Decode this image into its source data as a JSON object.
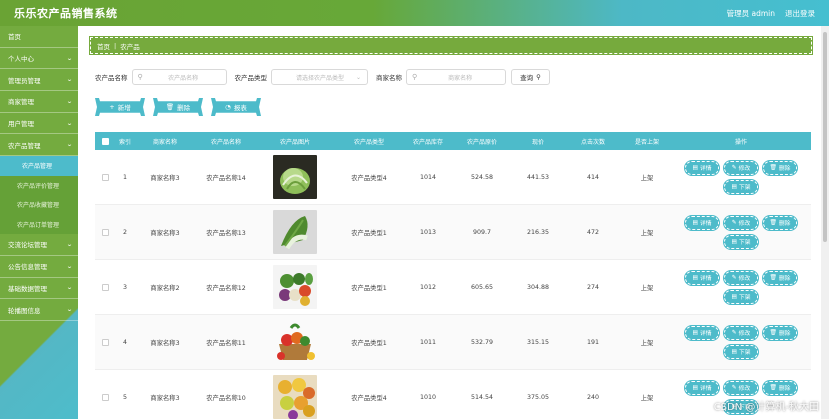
{
  "header": {
    "title": "乐乐农产品销售系统",
    "user": "管理员 admin",
    "logout": "退出登录"
  },
  "sidebar": {
    "items": [
      {
        "label": "首页",
        "chevron": false
      },
      {
        "label": "个人中心",
        "chevron": true
      },
      {
        "label": "管理员管理",
        "chevron": true
      },
      {
        "label": "商家管理",
        "chevron": true
      },
      {
        "label": "用户管理",
        "chevron": true
      },
      {
        "label": "农产品管理",
        "chevron": true
      }
    ],
    "submenu": [
      "农产品管理",
      "农产品评价管理",
      "农产品收藏管理",
      "农产品订单管理"
    ],
    "items_after": [
      {
        "label": "交流论坛管理"
      },
      {
        "label": "公告信息管理"
      },
      {
        "label": "基础数据管理"
      },
      {
        "label": "轮播图信息"
      }
    ]
  },
  "breadcrumb": {
    "home": "首页",
    "sep": "|",
    "current": "农产品"
  },
  "search": {
    "product_name_label": "农产品名称",
    "product_name_placeholder": "农产品名称",
    "product_type_label": "农产品类型",
    "product_type_placeholder": "请选择农产品类型",
    "shop_name_label": "商家名称",
    "shop_name_placeholder": "商家名称",
    "query_label": "查询"
  },
  "actions": {
    "add": "新增",
    "delete": "删除",
    "report": "报表"
  },
  "table": {
    "headers": [
      "索引",
      "商家名称",
      "农产品名称",
      "农产品图片",
      "农产品类型",
      "农产品库存",
      "农产品原价",
      "现价",
      "点击次数",
      "是否上架",
      "操作"
    ],
    "rows": [
      {
        "idx": "1",
        "shop": "商家名称3",
        "name": "农产品名称14",
        "type": "农产品类型4",
        "stock": "1014",
        "orig": "524.58",
        "price": "441.53",
        "clicks": "414",
        "status": "上架",
        "img": "cabbage"
      },
      {
        "idx": "2",
        "shop": "商家名称3",
        "name": "农产品名称13",
        "type": "农产品类型1",
        "stock": "1013",
        "orig": "909.7",
        "price": "216.35",
        "clicks": "472",
        "status": "上架",
        "img": "bokchoy"
      },
      {
        "idx": "3",
        "shop": "商家名称2",
        "name": "农产品名称12",
        "type": "农产品类型1",
        "stock": "1012",
        "orig": "605.65",
        "price": "304.88",
        "clicks": "274",
        "status": "上架",
        "img": "mixed"
      },
      {
        "idx": "4",
        "shop": "商家名称3",
        "name": "农产品名称11",
        "type": "农产品类型1",
        "stock": "1011",
        "orig": "532.79",
        "price": "315.15",
        "clicks": "191",
        "status": "上架",
        "img": "basket"
      },
      {
        "idx": "5",
        "shop": "商家名称3",
        "name": "农产品名称10",
        "type": "农产品类型4",
        "stock": "1010",
        "orig": "514.54",
        "price": "375.05",
        "clicks": "240",
        "status": "上架",
        "img": "fruits"
      }
    ],
    "ops": {
      "detail": "详情",
      "edit": "修改",
      "delete": "删除",
      "offshelf": "下架"
    }
  },
  "watermark": "CSDN @计算机-秋大田",
  "colors": {
    "green": "#74ab3f",
    "teal": "#4dbbca"
  }
}
